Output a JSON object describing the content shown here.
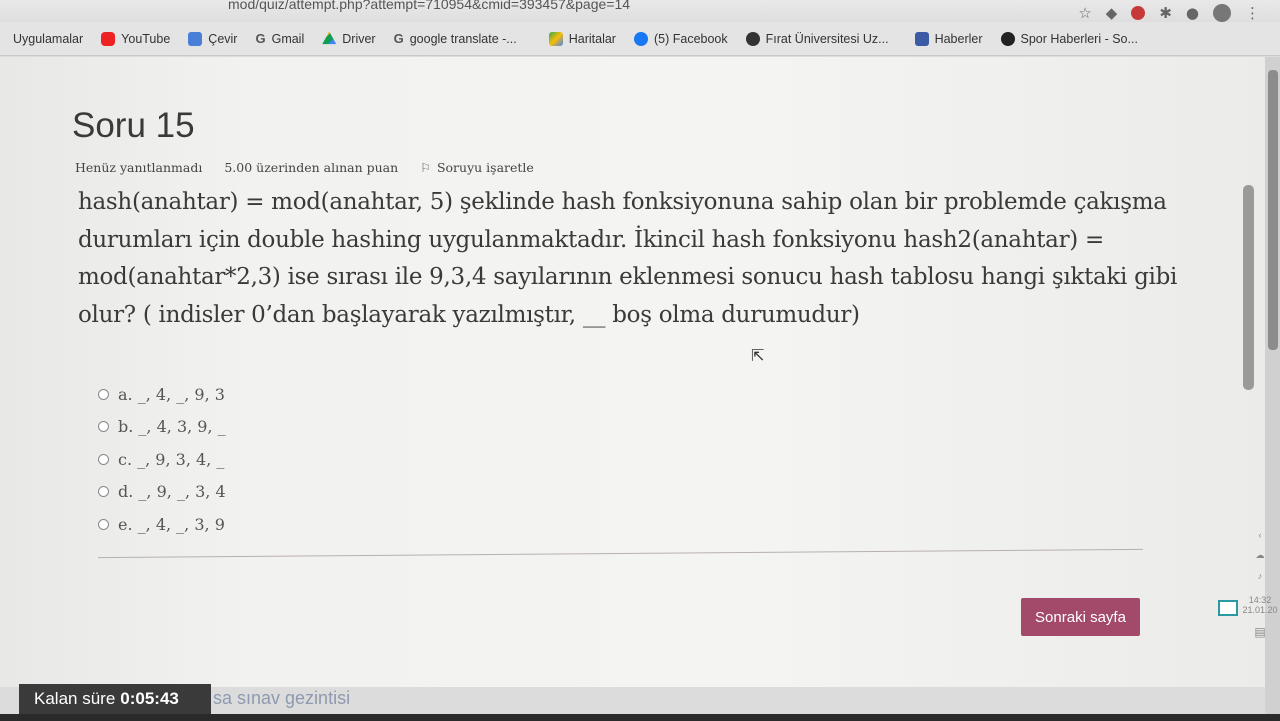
{
  "browser": {
    "url": "mod/quiz/attempt.php?attempt=710954&cmid=393457&page=14",
    "bookmarks": [
      {
        "label": "Uygulamalar",
        "icon": "apps-grid-icon"
      },
      {
        "label": "YouTube",
        "icon": "youtube-icon"
      },
      {
        "label": "Çevir",
        "icon": "translate-icon"
      },
      {
        "label": "Gmail",
        "icon": "google-icon"
      },
      {
        "label": "Driver",
        "icon": "drive-icon"
      },
      {
        "label": "google translate -...",
        "icon": "google-icon"
      },
      {
        "label": "Haritalar",
        "icon": "maps-icon"
      },
      {
        "label": "(5) Facebook",
        "icon": "facebook-icon"
      },
      {
        "label": "Fırat Üniversitesi Uz...",
        "icon": "university-icon"
      },
      {
        "label": "Haberler",
        "icon": "news-icon"
      },
      {
        "label": "Spor Haberleri - So...",
        "icon": "sport-icon"
      }
    ]
  },
  "question": {
    "title": "Soru 15",
    "status": "Henüz yanıtlanmadı",
    "points": "5.00 üzerinden alınan puan",
    "flag_label": "Soruyu işaretle",
    "text": "hash(anahtar) = mod(anahtar, 5) şeklinde hash fonksiyonuna sahip olan bir problemde çakışma durumları için double hashing uygulanmaktadır. İkincil hash fonksiyonu hash2(anahtar) = mod(anahtar*2,3) ise sırası ile 9,3,4 sayılarının eklenmesi sonucu hash tablosu hangi şıktaki gibi olur? ( indisler 0’dan başlayarak yazılmıştır, __ boş olma durumudur)",
    "answers": [
      {
        "label": "a. _, 4, _, 9, 3"
      },
      {
        "label": "b. _, 4, 3, 9, _"
      },
      {
        "label": "c. _, 9, 3, 4, _"
      },
      {
        "label": "d. _, 9, _, 3, 4"
      },
      {
        "label": "e. _, 4, _, 3, 9"
      }
    ]
  },
  "footer": {
    "next_button": "Sonraki sayfa",
    "timer_label": "Kalan süre",
    "timer_value": "0:05:43",
    "nav_link": "sa sınav gezintisi"
  },
  "system_tray": {
    "time": "14:32",
    "date": "21.01.20"
  },
  "colors": {
    "next_button": "#a34a6a",
    "timer_bg": "#3a3a3a"
  }
}
